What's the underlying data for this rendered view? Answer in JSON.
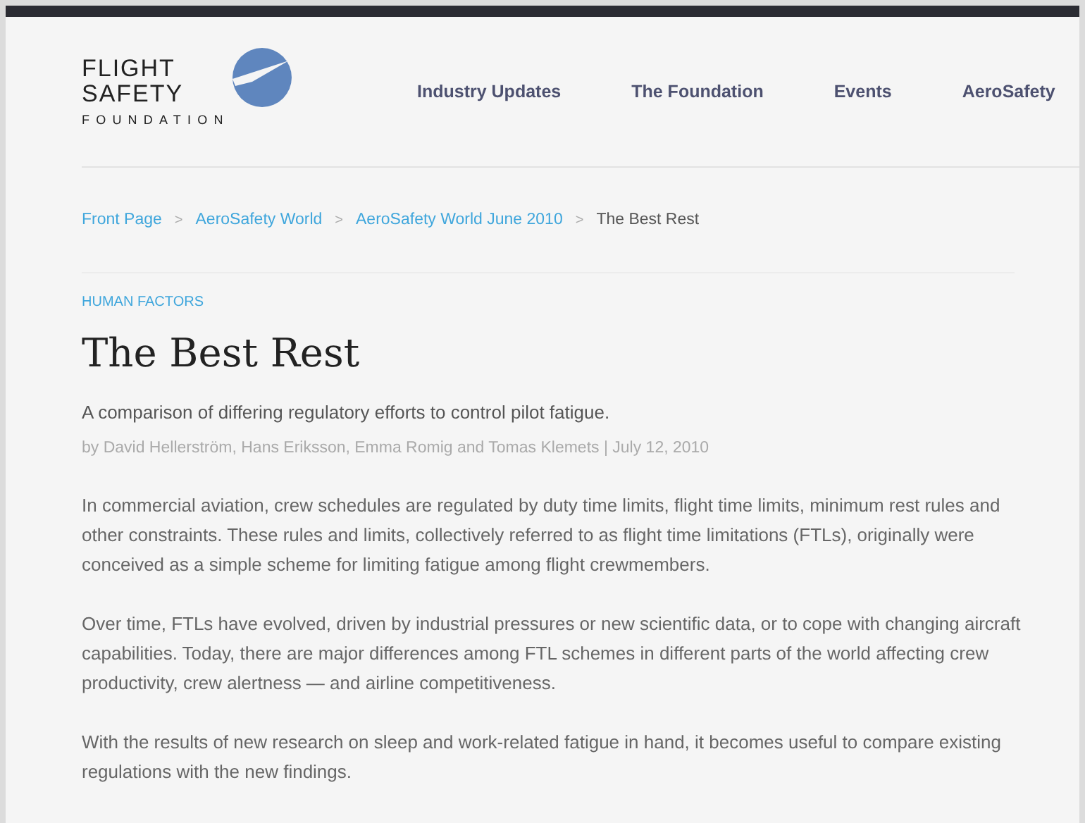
{
  "logo": {
    "lines": [
      "FLIGHT",
      "SAFETY",
      "FOUNDATION"
    ]
  },
  "nav": [
    "Industry Updates",
    "The Foundation",
    "Events",
    "AeroSafety"
  ],
  "breadcrumb": [
    {
      "label": "Front Page",
      "kind": "link"
    },
    {
      "label": "AeroSafety World",
      "kind": "link"
    },
    {
      "label": "AeroSafety World June 2010",
      "kind": "link"
    },
    {
      "label": "The Best Rest",
      "kind": "current"
    }
  ],
  "breadcrumb_separator": ">",
  "category": "HUMAN FACTORS",
  "title": "The Best Rest",
  "subtitle": "A comparison of differing regulatory efforts to control pilot fatigue.",
  "byline": "by David Hellerström, Hans Eriksson, Emma Romig and Tomas Klemets | July 12, 2010",
  "paragraphs": [
    "In commercial aviation, crew schedules are regulated by duty time limits, flight time limits, minimum rest rules and other constraints. These rules and limits, collectively referred to as flight time limitations (FTLs), originally were conceived as a simple scheme for limiting fatigue among flight crewmembers.",
    "Over time, FTLs have evolved, driven by industrial pressures or new scientific data, or to cope with changing aircraft capabilities. Today, there are major differences among FTL schemes in different parts of the world affecting crew productivity, crew alertness — and airline competitiveness.",
    "With the results of new research on sleep and work-related fatigue in hand, it becomes useful to compare existing regulations with the new findings."
  ]
}
